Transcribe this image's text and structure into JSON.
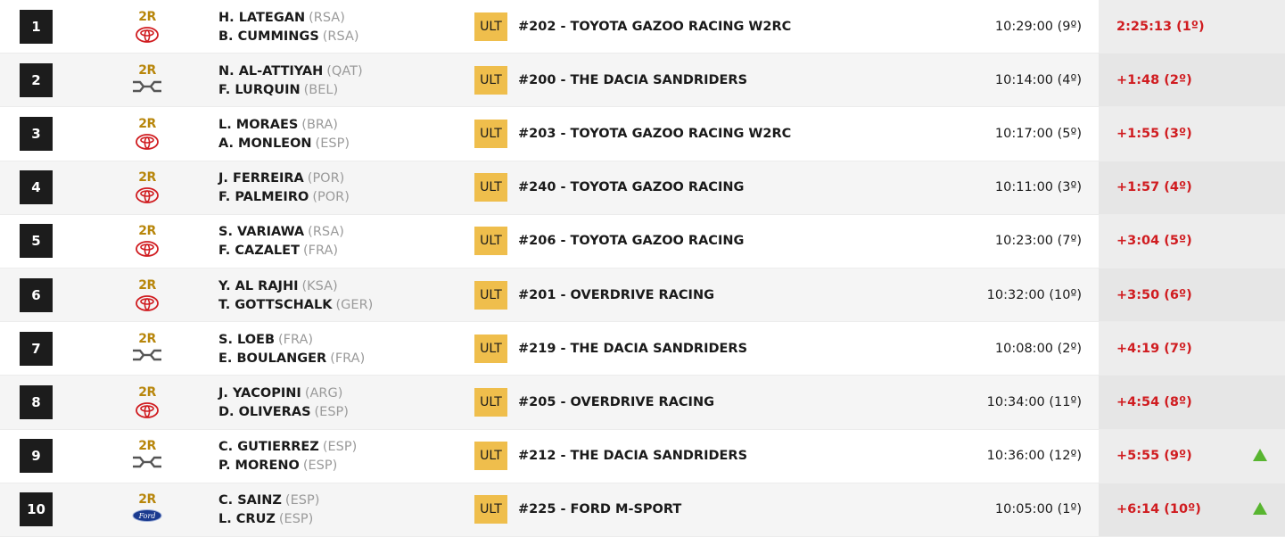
{
  "colors": {
    "position_bg": "#1c1c1c",
    "category_bg": "#efbe4c",
    "gap_text": "#d01c20",
    "up_arrow": "#58b530",
    "brand_2r": "#b8860b"
  },
  "rows": [
    {
      "pos": "1",
      "brand_text": "2R",
      "brand_icon": "toyota-logo-icon",
      "driver": "H. LATEGAN",
      "driver_nat": "(RSA)",
      "codriver": "B. CUMMINGS",
      "codriver_nat": "(RSA)",
      "category": "ULT",
      "team": "#202 - TOYOTA GAZOO RACING W2RC",
      "start": "10:29:00 (9º)",
      "result": "2:25:13 (1º)",
      "trend": ""
    },
    {
      "pos": "2",
      "brand_text": "2R",
      "brand_icon": "dacia-logo-icon",
      "driver": "N. AL-ATTIYAH",
      "driver_nat": "(QAT)",
      "codriver": "F. LURQUIN",
      "codriver_nat": "(BEL)",
      "category": "ULT",
      "team": "#200 - THE DACIA SANDRIDERS",
      "start": "10:14:00 (4º)",
      "result": "+1:48 (2º)",
      "trend": ""
    },
    {
      "pos": "3",
      "brand_text": "2R",
      "brand_icon": "toyota-logo-icon",
      "driver": "L. MORAES",
      "driver_nat": "(BRA)",
      "codriver": "A. MONLEON",
      "codriver_nat": "(ESP)",
      "category": "ULT",
      "team": "#203 - TOYOTA GAZOO RACING W2RC",
      "start": "10:17:00 (5º)",
      "result": "+1:55 (3º)",
      "trend": ""
    },
    {
      "pos": "4",
      "brand_text": "2R",
      "brand_icon": "toyota-logo-icon",
      "driver": "J. FERREIRA",
      "driver_nat": "(POR)",
      "codriver": "F. PALMEIRO",
      "codriver_nat": "(POR)",
      "category": "ULT",
      "team": "#240 - TOYOTA GAZOO RACING",
      "start": "10:11:00 (3º)",
      "result": "+1:57 (4º)",
      "trend": ""
    },
    {
      "pos": "5",
      "brand_text": "2R",
      "brand_icon": "toyota-logo-icon",
      "driver": "S. VARIAWA",
      "driver_nat": "(RSA)",
      "codriver": "F. CAZALET",
      "codriver_nat": "(FRA)",
      "category": "ULT",
      "team": "#206 - TOYOTA GAZOO RACING",
      "start": "10:23:00 (7º)",
      "result": "+3:04 (5º)",
      "trend": ""
    },
    {
      "pos": "6",
      "brand_text": "2R",
      "brand_icon": "toyota-logo-icon",
      "driver": "Y. AL RAJHI",
      "driver_nat": "(KSA)",
      "codriver": "T. GOTTSCHALK",
      "codriver_nat": "(GER)",
      "category": "ULT",
      "team": "#201 - OVERDRIVE RACING",
      "start": "10:32:00 (10º)",
      "result": "+3:50 (6º)",
      "trend": ""
    },
    {
      "pos": "7",
      "brand_text": "2R",
      "brand_icon": "dacia-logo-icon",
      "driver": "S. LOEB",
      "driver_nat": "(FRA)",
      "codriver": "E. BOULANGER",
      "codriver_nat": "(FRA)",
      "category": "ULT",
      "team": "#219 - THE DACIA SANDRIDERS",
      "start": "10:08:00 (2º)",
      "result": "+4:19 (7º)",
      "trend": ""
    },
    {
      "pos": "8",
      "brand_text": "2R",
      "brand_icon": "toyota-logo-icon",
      "driver": "J. YACOPINI",
      "driver_nat": "(ARG)",
      "codriver": "D. OLIVERAS",
      "codriver_nat": "(ESP)",
      "category": "ULT",
      "team": "#205 - OVERDRIVE RACING",
      "start": "10:34:00 (11º)",
      "result": "+4:54 (8º)",
      "trend": ""
    },
    {
      "pos": "9",
      "brand_text": "2R",
      "brand_icon": "dacia-logo-icon",
      "driver": "C. GUTIERREZ",
      "driver_nat": "(ESP)",
      "codriver": "P. MORENO",
      "codriver_nat": "(ESP)",
      "category": "ULT",
      "team": "#212 - THE DACIA SANDRIDERS",
      "start": "10:36:00 (12º)",
      "result": "+5:55 (9º)",
      "trend": "up"
    },
    {
      "pos": "10",
      "brand_text": "2R",
      "brand_icon": "ford-logo-icon",
      "driver": "C. SAINZ",
      "driver_nat": "(ESP)",
      "codriver": "L. CRUZ",
      "codriver_nat": "(ESP)",
      "category": "ULT",
      "team": "#225 - FORD M-SPORT",
      "start": "10:05:00 (1º)",
      "result": "+6:14 (10º)",
      "trend": "up"
    }
  ]
}
